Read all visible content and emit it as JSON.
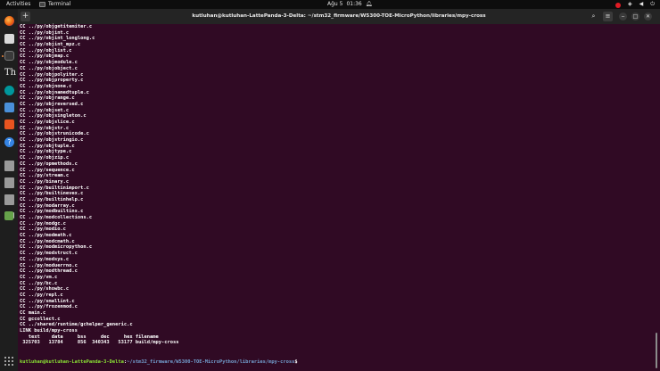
{
  "topbar": {
    "activities": "Activities",
    "app_name": "Terminal",
    "date": "Ağu 5",
    "time": "01:36",
    "icons": [
      "notification-bell-icon",
      "recording-icon",
      "network-icon",
      "volume-icon",
      "power-icon"
    ]
  },
  "dock": {
    "items": [
      "firefox-icon",
      "files-icon",
      "terminal-icon",
      "font-viewer-icon",
      "arduino-icon",
      "text-editor-icon",
      "app-store-icon",
      "help-icon",
      "drive-icon",
      "drive-icon",
      "drive-icon",
      "keyboard-icon",
      "trash-icon",
      "show-apps-icon"
    ]
  },
  "window": {
    "title": "kutluhan@kutluhan-LattePanda-3-Delta: ~/stm32_firmware/W5300-TOE-MicroPython/libraries/mpy-cross",
    "buttons": [
      "new-tab-icon",
      "search-icon",
      "menu-icon",
      "minimize-icon",
      "maximize-icon",
      "close-icon"
    ]
  },
  "terminal": {
    "lines": [
      "CC ../py/objgetitemiter.c",
      "CC ../py/objint.c",
      "CC ../py/objint_longlong.c",
      "CC ../py/objint_mpz.c",
      "CC ../py/objlist.c",
      "CC ../py/objmap.c",
      "CC ../py/objmodule.c",
      "CC ../py/objobject.c",
      "CC ../py/objpolyiter.c",
      "CC ../py/objproperty.c",
      "CC ../py/objnone.c",
      "CC ../py/objnamedtuple.c",
      "CC ../py/objrange.c",
      "CC ../py/objreversed.c",
      "CC ../py/objset.c",
      "CC ../py/objsingleton.c",
      "CC ../py/objslice.c",
      "CC ../py/objstr.c",
      "CC ../py/objstrunicode.c",
      "CC ../py/objstringio.c",
      "CC ../py/objtuple.c",
      "CC ../py/objtype.c",
      "CC ../py/objzip.c",
      "CC ../py/opmethods.c",
      "CC ../py/sequence.c",
      "CC ../py/stream.c",
      "CC ../py/binary.c",
      "CC ../py/builtinimport.c",
      "CC ../py/builtinevex.c",
      "CC ../py/builtinhelp.c",
      "CC ../py/modarray.c",
      "CC ../py/modbuiltins.c",
      "CC ../py/modcollections.c",
      "CC ../py/modgc.c",
      "CC ../py/modio.c",
      "CC ../py/modmath.c",
      "CC ../py/modcmath.c",
      "CC ../py/modmicropython.c",
      "CC ../py/modstruct.c",
      "CC ../py/modsys.c",
      "CC ../py/moduerrno.c",
      "CC ../py/modthread.c",
      "CC ../py/vm.c",
      "CC ../py/bc.c",
      "CC ../py/showbc.c",
      "CC ../py/repl.c",
      "CC ../py/smallint.c",
      "CC ../py/frozenmod.c",
      "CC main.c",
      "CC gccollect.c",
      "CC ../shared/runtime/gchelper_generic.c",
      "LINK build/mpy-cross",
      "   text    data     bss     dec     hex filename",
      " 325703   13784     856  340343   53177 build/mpy-cross"
    ],
    "prompt": {
      "user": "kutluhan@kutluhan-LattePanda-3-Delta",
      "separator": ":",
      "path": "~/stm32_firmware/W5300-TOE-MicroPython/libraries/mpy-cross",
      "symbol": "$"
    }
  }
}
